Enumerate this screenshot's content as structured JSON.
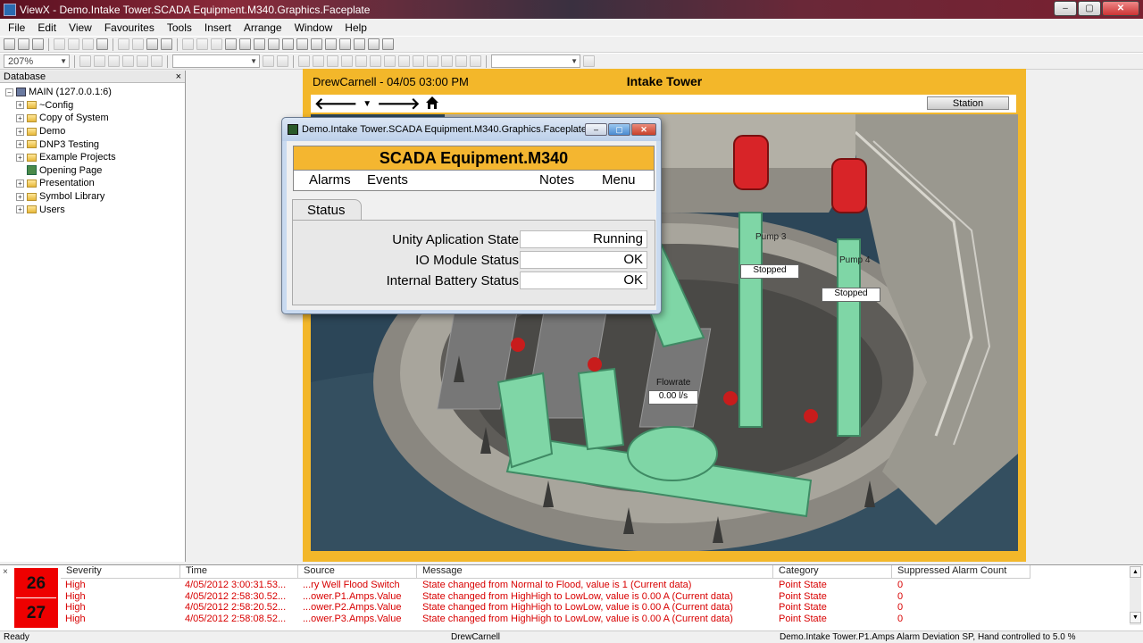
{
  "window": {
    "title": "ViewX - Demo.Intake Tower.SCADA Equipment.M340.Graphics.Faceplate",
    "min": "–",
    "max": "▢",
    "close": "✕"
  },
  "menu": [
    "File",
    "Edit",
    "View",
    "Favourites",
    "Tools",
    "Insert",
    "Arrange",
    "Window",
    "Help"
  ],
  "toolbar": {
    "zoom": "207%"
  },
  "database": {
    "title": "Database",
    "close": "×",
    "tree": [
      {
        "label": "MAIN (127.0.0.1:6)",
        "level": 0,
        "icon": "computer-icon",
        "expander": "−"
      },
      {
        "label": "~Config",
        "level": 1,
        "icon": "folder-icon",
        "expander": "+"
      },
      {
        "label": "Copy of System",
        "level": 1,
        "icon": "folder-icon",
        "expander": "+"
      },
      {
        "label": "Demo",
        "level": 1,
        "icon": "folder-icon",
        "expander": "+"
      },
      {
        "label": "DNP3 Testing",
        "level": 1,
        "icon": "folder-icon",
        "expander": "+"
      },
      {
        "label": "Example Projects",
        "level": 1,
        "icon": "folder-icon",
        "expander": "+"
      },
      {
        "label": "Opening Page",
        "level": 1,
        "icon": "page-icon",
        "expander": ""
      },
      {
        "label": "Presentation",
        "level": 1,
        "icon": "folder-icon",
        "expander": "+"
      },
      {
        "label": "Symbol Library",
        "level": 1,
        "icon": "folder-icon",
        "expander": "+"
      },
      {
        "label": "Users",
        "level": 1,
        "icon": "folder-icon",
        "expander": "+"
      }
    ]
  },
  "graphic": {
    "user_time": "DrewCarnell - 04/05 03:00 PM",
    "title": "Intake Tower",
    "station_button": "Station",
    "pumps": [
      {
        "name": "Pump 3",
        "state": "Stopped"
      },
      {
        "name": "Pump 4",
        "state": "Stopped"
      }
    ],
    "flow": {
      "label": "Flowrate",
      "value": "0.00 l/s"
    }
  },
  "faceplate": {
    "title": "Demo.Intake Tower.SCADA Equipment.M340.Graphics.Faceplate",
    "min": "–",
    "max": "▢",
    "close": "✕",
    "header": "SCADA Equipment.M340",
    "menu": {
      "alarms": "Alarms",
      "events": "Events",
      "notes": "Notes",
      "menu": "Menu"
    },
    "tab": "Status",
    "rows": [
      {
        "label": "Unity Aplication State",
        "value": "Running"
      },
      {
        "label": "IO Module Status",
        "value": "OK"
      },
      {
        "label": "Internal Battery Status",
        "value": "OK"
      }
    ]
  },
  "alarms": {
    "close": "×",
    "counts": [
      "26",
      "27"
    ],
    "columns": [
      "Severity",
      "Time",
      "Source",
      "Message",
      "Category",
      "Suppressed Alarm Count"
    ],
    "rows": [
      [
        "High",
        "4/05/2012  3:00:31.53...",
        "...ry Well Flood Switch",
        "State changed from Normal to Flood, value is 1 (Current data)",
        "Point State",
        "0"
      ],
      [
        "High",
        "4/05/2012  2:58:30.52...",
        "...ower.P1.Amps.Value",
        "State changed from HighHigh to LowLow, value is 0.00 A (Current data)",
        "Point State",
        "0"
      ],
      [
        "High",
        "4/05/2012  2:58:20.52...",
        "...ower.P2.Amps.Value",
        "State changed from HighHigh to LowLow, value is 0.00 A (Current data)",
        "Point State",
        "0"
      ],
      [
        "High",
        "4/05/2012  2:58:08.52...",
        "...ower.P3.Amps.Value",
        "State changed from HighHigh to LowLow, value is 0.00 A (Current data)",
        "Point State",
        "0"
      ]
    ],
    "severity_color": "#d80000"
  },
  "statusbar": {
    "left": "Ready",
    "user": "DrewCarnell",
    "right": "Demo.Intake Tower.P1.Amps Alarm Deviation SP, Hand controlled to 5.0 %"
  }
}
